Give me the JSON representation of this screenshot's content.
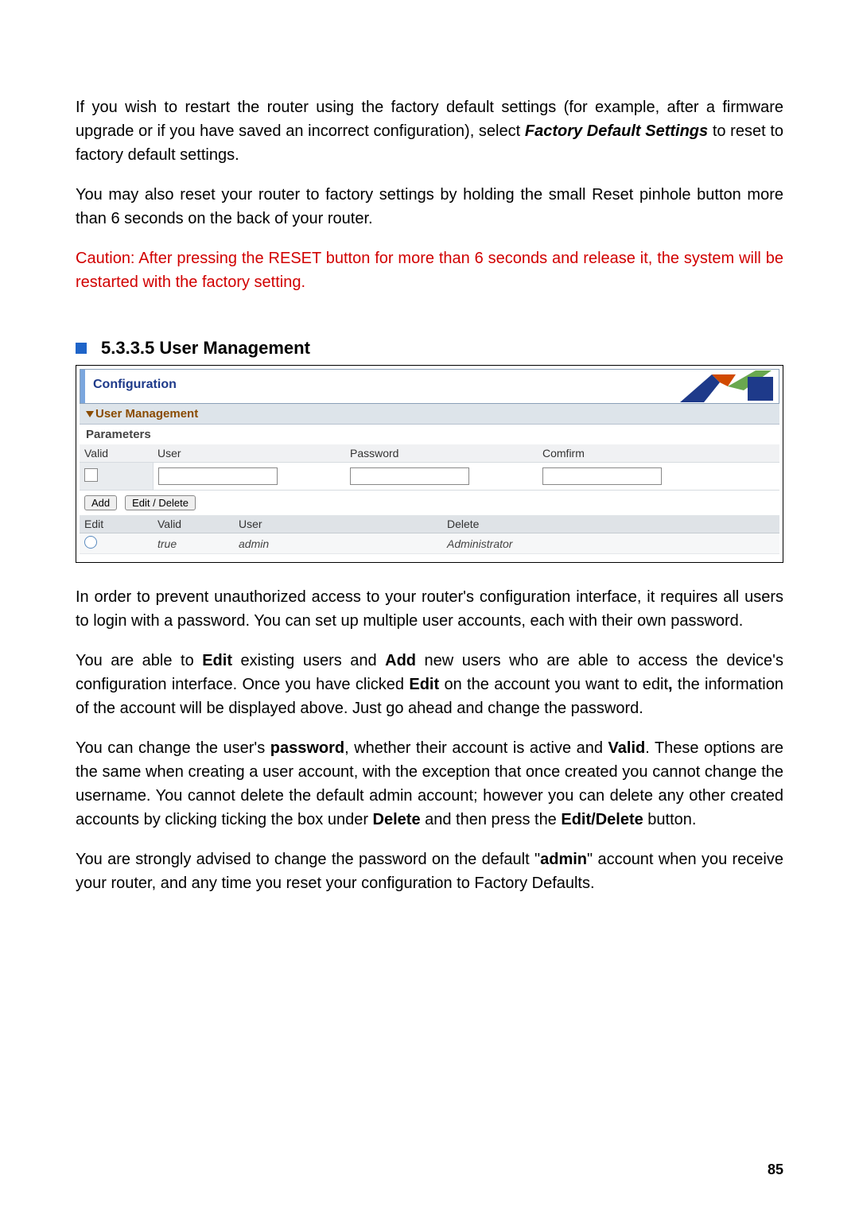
{
  "paragraphs": {
    "p1_a": "If you wish to restart the router using the factory default settings (for example, after a firmware upgrade or if you have saved an incorrect configuration), select ",
    "p1_b": "Factory Default Settings",
    "p1_c": " to reset to factory default settings.",
    "p2": "You may also reset your router to factory settings by holding the small Reset pinhole button more than 6 seconds on the back of your router.",
    "p3": "Caution: After pressing the RESET button for more than 6 seconds and release it, the system will be restarted with the factory setting.",
    "p4": "In order to prevent unauthorized access to your router's configuration interface, it requires all users to login with a password. You can set up multiple user accounts, each with their own password.",
    "p5_a": "You are able to ",
    "p5_b": "Edit",
    "p5_c": " existing users and ",
    "p5_d": "Add",
    "p5_e": " new users who are able to access the device's configuration interface. Once you have clicked ",
    "p5_f": "Edit",
    "p5_g": " on the account you want to edit",
    "p5_h": ",",
    "p5_i": " the information of the account will be displayed above. Just go ahead and change the password.",
    "p6_a": "You can change the user's ",
    "p6_b": "password",
    "p6_c": ", whether their account is active and ",
    "p6_d": "Valid",
    "p6_e": ". These options are the same when creating a user account, with the exception that once created you cannot change the username. You cannot delete the default admin account; however you can delete any other created accounts by clicking ticking the box under ",
    "p6_f": "Delete",
    "p6_g": " and then press the ",
    "p6_h": "Edit/Delete",
    "p6_i": " button.",
    "p7_a": "You are strongly advised to change the password on the default \"",
    "p7_b": "admin",
    "p7_c": "\" account when you receive your router, and any time you reset your configuration to Factory Defaults."
  },
  "section": {
    "number_title": "5.3.3.5 User Management"
  },
  "panel": {
    "config_title": "Configuration",
    "subsection": "User Management",
    "parameters_label": "Parameters",
    "form_headers": {
      "valid": "Valid",
      "user": "User",
      "password": "Password",
      "confirm": "Comfirm"
    },
    "form_values": {
      "user": "",
      "password": "",
      "confirm": ""
    },
    "buttons": {
      "add": "Add",
      "edit_delete": "Edit / Delete"
    },
    "list_headers": {
      "edit": "Edit",
      "valid": "Valid",
      "user": "User",
      "delete": "Delete"
    },
    "rows": [
      {
        "valid": "true",
        "user": "admin",
        "delete": "Administrator"
      }
    ]
  },
  "page_number": "85"
}
